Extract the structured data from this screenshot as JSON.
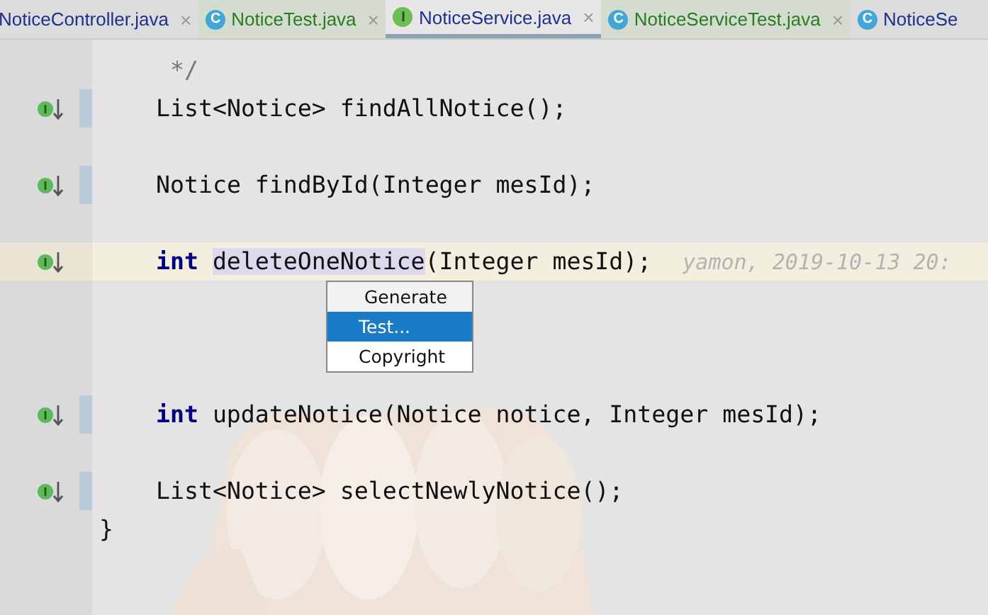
{
  "tabs": [
    {
      "label": "NoticeController.java",
      "test": false,
      "selected": false,
      "close": "×"
    },
    {
      "label": "NoticeTest.java",
      "icon": "C",
      "test": true,
      "selected": false,
      "close": "×"
    },
    {
      "label": "NoticeService.java",
      "icon": "I",
      "test": false,
      "selected": true,
      "close": "×"
    },
    {
      "label": "NoticeServiceTest.java",
      "icon": "C",
      "test": true,
      "selected": false,
      "close": "×"
    },
    {
      "label": "NoticeSe",
      "icon": "C",
      "test": false,
      "selected": false
    }
  ],
  "lines": [
    {
      "tokens": [
        {
          "kind": "comment",
          "text": "*/"
        }
      ],
      "gutter_icon": false,
      "current": false
    },
    {
      "tokens": [
        {
          "kind": "plain",
          "text": "List<Notice> findAllNotice();"
        }
      ],
      "gutter_icon": true,
      "current": false
    },
    {
      "gutter_icon": false,
      "current": false
    },
    {
      "tokens": [
        {
          "kind": "plain",
          "text": "Notice findById(Integer mesId);"
        }
      ],
      "gutter_icon": true,
      "current": false
    },
    {
      "gutter_icon": false,
      "current": false
    },
    {
      "tokens": [
        {
          "kind": "keyword",
          "text": "int"
        },
        {
          "kind": "usage",
          "text": "deleteOneNotice"
        },
        {
          "kind": "plain",
          "text": "(Integer mesId);"
        }
      ],
      "gutter_icon": true,
      "current": true,
      "annotation": "yamon, 2019-10-13 20:"
    },
    {
      "gutter_icon": false,
      "current": false
    },
    {
      "gutter_icon": false,
      "current": false
    },
    {
      "gutter_icon": false,
      "current": false
    },
    {
      "tokens": [
        {
          "kind": "keyword",
          "text": "int"
        },
        {
          "kind": "plain",
          "text": "updateNotice(Notice notice, Integer mesId);"
        }
      ],
      "gutter_icon": true,
      "current": false
    },
    {
      "gutter_icon": false,
      "current": false
    },
    {
      "tokens": [
        {
          "kind": "plain",
          "text": "List<Notice> selectNewlyNotice();"
        }
      ],
      "gutter_icon": true,
      "current": false
    },
    {
      "tokens": [
        {
          "kind": "brace",
          "text": "}"
        }
      ],
      "gutter_icon": false,
      "current": false
    }
  ],
  "popup": {
    "items": [
      {
        "label": "Generate",
        "selected": false
      },
      {
        "label": "Test...",
        "selected": true
      },
      {
        "label": "Copyright",
        "selected": false
      }
    ]
  }
}
